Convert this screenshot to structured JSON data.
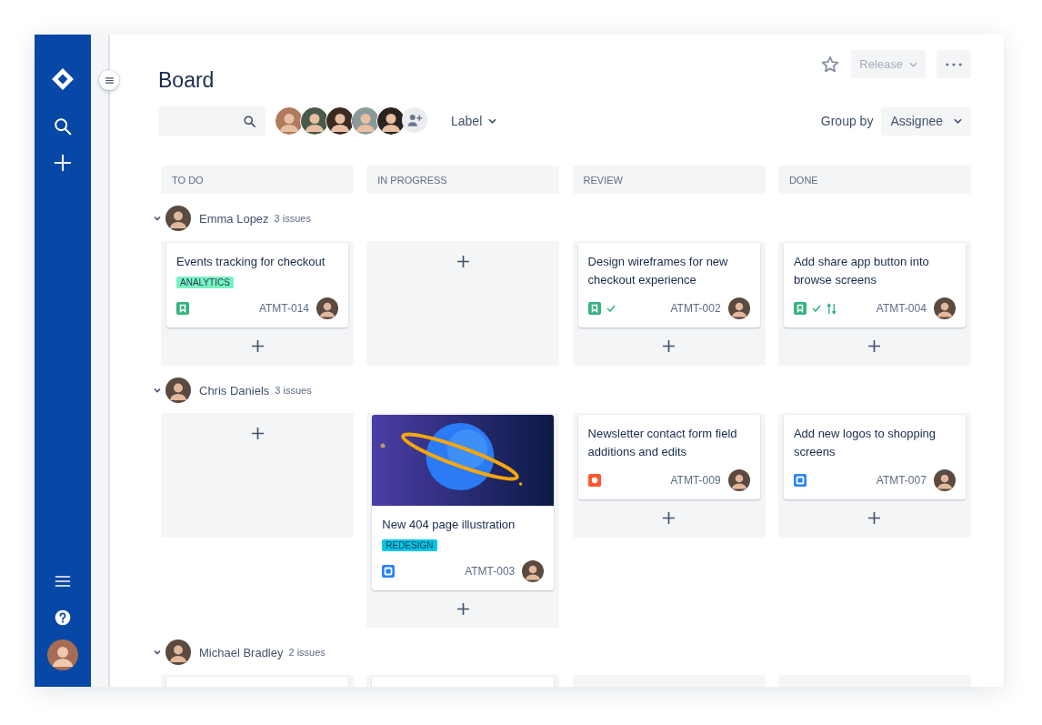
{
  "header": {
    "title": "Board",
    "release_button": {
      "label": "Release",
      "disabled": true
    },
    "label_filter": "Label",
    "group_by": {
      "label": "Group by",
      "value": "Assignee"
    }
  },
  "columns": [
    {
      "title": "TO DO"
    },
    {
      "title": "IN PROGRESS"
    },
    {
      "title": "REVIEW"
    },
    {
      "title": "DONE"
    }
  ],
  "lanes": [
    {
      "assignee": "Emma Lopez",
      "issue_count": "3 issues",
      "expanded": true,
      "cells": [
        {
          "add_button": true,
          "cards": [
            {
              "kind": "story",
              "cover": false,
              "title": "Events tracking for checkout",
              "label": {
                "text": "ANALYTICS",
                "color": "#79f2c0"
              },
              "done": false,
              "pull_request": false,
              "key": "ATMT-014"
            }
          ]
        },
        {
          "add_button": true
        },
        {
          "add_button": true,
          "cards": [
            {
              "kind": "story",
              "cover": false,
              "title": "Design wireframes for new checkout experience",
              "done": true,
              "pull_request": false,
              "key": "ATMT-002"
            }
          ]
        },
        {
          "add_button": true,
          "cards": [
            {
              "kind": "story",
              "cover": false,
              "title": "Add share app button into browse screens",
              "done": true,
              "pull_request": true,
              "key": "ATMT-004"
            }
          ]
        }
      ]
    },
    {
      "assignee": "Chris Daniels",
      "issue_count": "3 issues",
      "expanded": true,
      "cells": [
        {
          "add_button": true
        },
        {
          "add_button": true,
          "cards": [
            {
              "kind": "task",
              "cover": true,
              "title": "New 404 page illustration",
              "label": {
                "text": "REDESIGN",
                "color": "#00c7e6"
              },
              "done": false,
              "pull_request": false,
              "key": "ATMT-003"
            }
          ]
        },
        {
          "add_button": true,
          "cards": [
            {
              "kind": "bug",
              "cover": false,
              "title": "Newsletter contact form field additions and edits",
              "done": false,
              "pull_request": false,
              "key": "ATMT-009"
            }
          ]
        },
        {
          "add_button": true,
          "cards": [
            {
              "kind": "task",
              "cover": false,
              "title": "Add new logos to shopping screens",
              "done": false,
              "pull_request": false,
              "key": "ATMT-007"
            }
          ]
        }
      ]
    },
    {
      "assignee": "Michael Bradley",
      "issue_count": "2 issues",
      "expanded": true,
      "cells": [
        {
          "add_button": false,
          "cards": [
            {
              "kind": "blank"
            }
          ]
        },
        {
          "add_button": false,
          "cards": [
            {
              "kind": "blank"
            }
          ]
        },
        {
          "add_button": false
        },
        {
          "add_button": false
        }
      ]
    }
  ]
}
